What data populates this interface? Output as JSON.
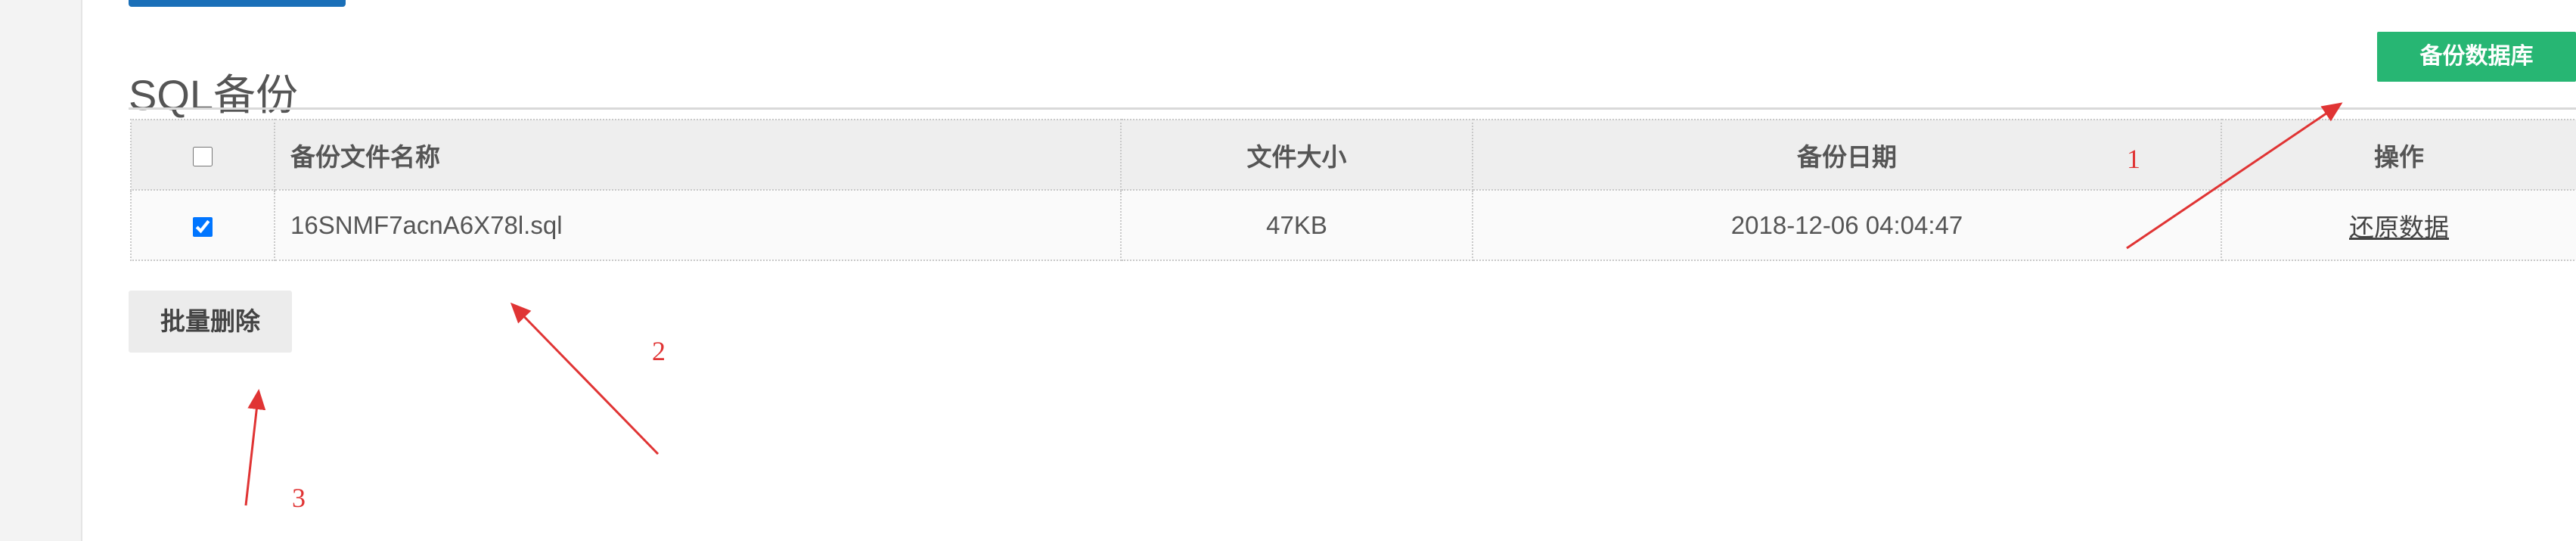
{
  "header": {
    "title": "SQL备份",
    "backup_button": "备份数据库"
  },
  "table": {
    "columns": [
      "",
      "备份文件名称",
      "文件大小",
      "备份日期",
      "操作"
    ],
    "header_checkbox_checked": false,
    "rows": [
      {
        "checked": true,
        "filename": "16SNMF7acnA6X78l.sql",
        "size": "47KB",
        "date": "2018-12-06 04:04:47",
        "action": "还原数据"
      }
    ]
  },
  "footer": {
    "batch_delete_button": "批量删除"
  },
  "annotations": {
    "labels": [
      "1",
      "2",
      "3"
    ],
    "color": "#e03434"
  },
  "colors": {
    "primary_button": "#27b673",
    "top_bar": "#1a6fb8"
  }
}
